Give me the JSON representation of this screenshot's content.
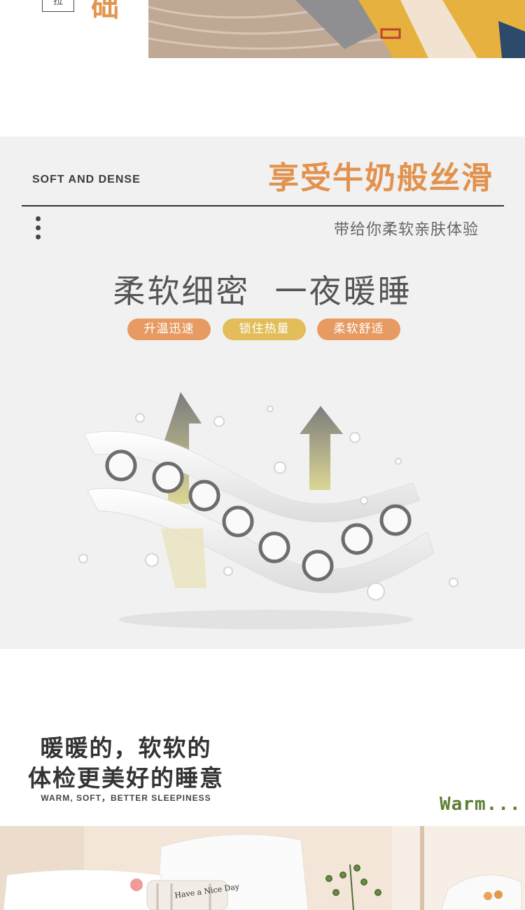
{
  "top": {
    "box_char": "拉",
    "heading_char": "础"
  },
  "soft_section": {
    "english_label": "SOFT AND DENSE",
    "title": "享受牛奶般丝滑",
    "subtitle": "带给你柔软亲肤体验",
    "headline": "柔软细密  一夜暖睡",
    "features": [
      "升温迅速",
      "锁住热量",
      "柔软舒适"
    ]
  },
  "warm_section": {
    "title_line1": "暖暖的，软软的",
    "title_line2": "体检更美好的睡意",
    "english_caption": "WARM, SOFT，BETTER SLEEPINESS",
    "script_text": "Warm..."
  },
  "bottom_photo": {
    "pillow_text": "Have a Nice Day"
  },
  "colors": {
    "accent_orange": "#e2924d",
    "pill_orange": "#e79a61",
    "pill_yellow": "#e2bd5a",
    "section_bg": "#f1f1f1",
    "script_green": "#5d7f35"
  }
}
